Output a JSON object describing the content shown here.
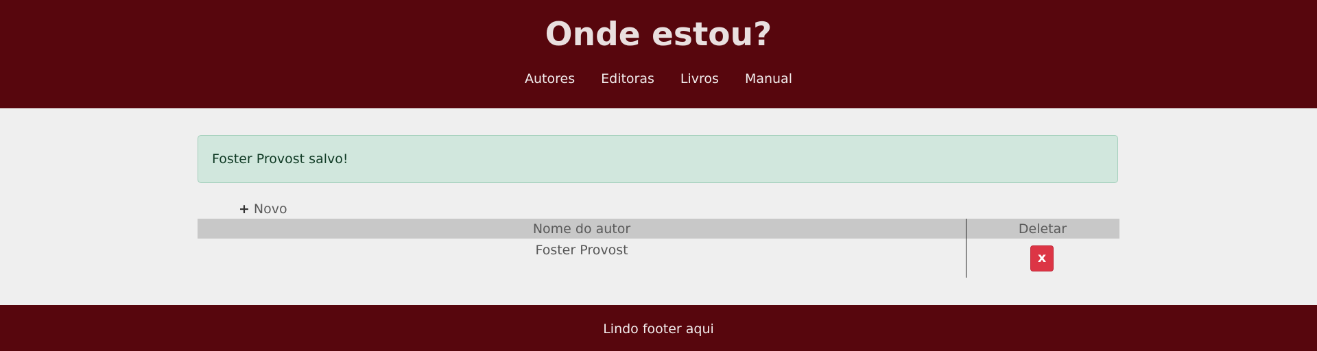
{
  "header": {
    "title": "Onde estou?",
    "nav": [
      "Autores",
      "Editoras",
      "Livros",
      "Manual"
    ]
  },
  "alert": {
    "message": "Foster Provost salvo!"
  },
  "actions": {
    "new_label": "Novo",
    "new_icon": "plus-icon"
  },
  "table": {
    "columns": [
      "Nome do autor",
      "Deletar"
    ],
    "rows": [
      {
        "name": "Foster Provost",
        "delete_label": "x"
      }
    ]
  },
  "footer": {
    "text": "Lindo footer aqui"
  },
  "colors": {
    "brand": "#57060d",
    "background": "#efefef",
    "alert_bg": "#d1e7dd",
    "delete_button": "#dc3545",
    "table_header": "#c8c8c8"
  }
}
